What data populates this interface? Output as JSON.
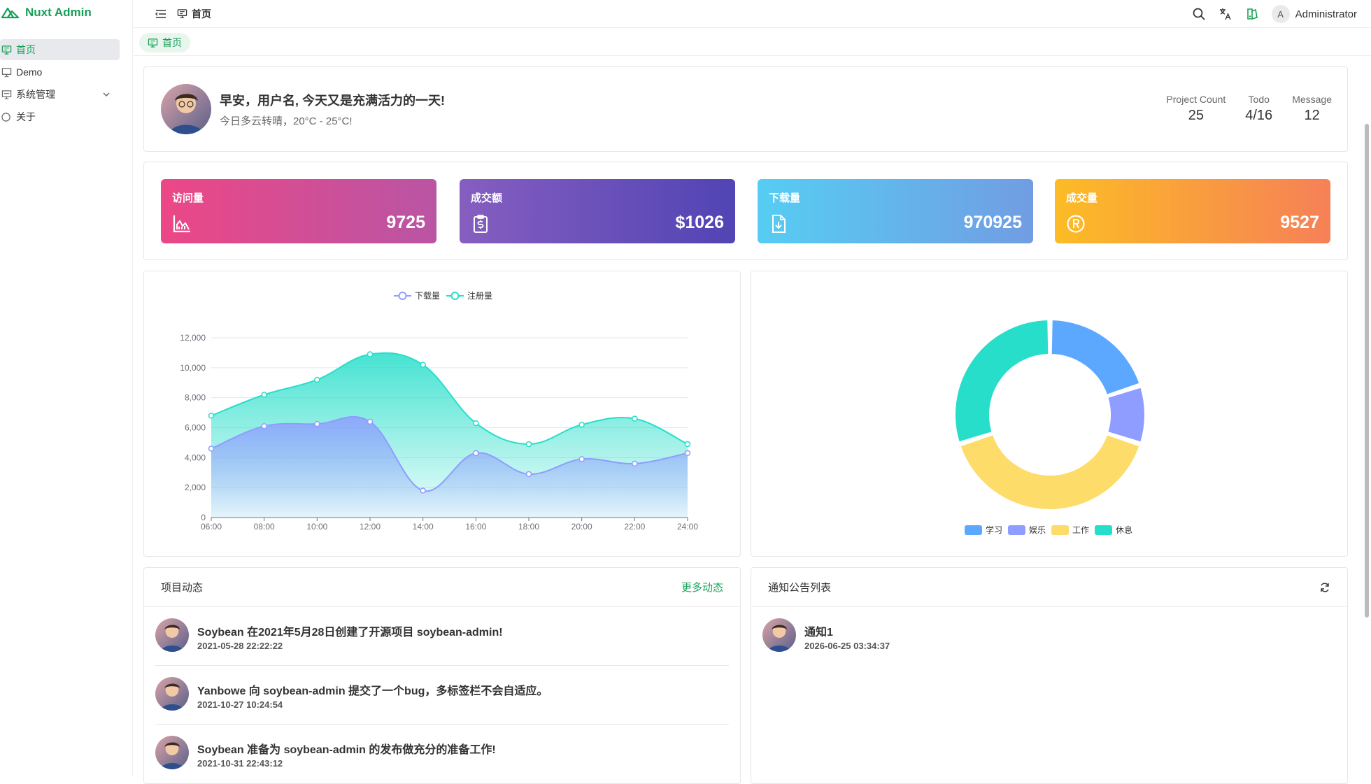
{
  "app": {
    "title": "Nuxt Admin"
  },
  "sidebar": {
    "items": [
      {
        "label": "首页",
        "icon": "monitor-icon",
        "active": true
      },
      {
        "label": "Demo",
        "icon": "presentation-icon"
      },
      {
        "label": "系统管理",
        "icon": "system-icon",
        "expandable": true
      },
      {
        "label": "关于",
        "icon": "circle-icon"
      }
    ]
  },
  "header": {
    "breadcrumb": "首页",
    "user_initial": "A",
    "user_name": "Administrator"
  },
  "tabs": [
    {
      "label": "首页"
    }
  ],
  "greeting": {
    "title": "早安，用户名, 今天又是充满活力的一天!",
    "subtitle": "今日多云转晴，20°C - 25°C!",
    "stats": [
      {
        "label": "Project Count",
        "value": "25"
      },
      {
        "label": "Todo",
        "value": "4/16"
      },
      {
        "label": "Message",
        "value": "12"
      }
    ]
  },
  "kpis": [
    {
      "title": "访问量",
      "value": "9725",
      "icon": "chart-icon",
      "from": "#ec4786",
      "to": "#b955a4"
    },
    {
      "title": "成交额",
      "value": "$1026",
      "icon": "money-clipboard-icon",
      "from": "#865ec0",
      "to": "#5144b4"
    },
    {
      "title": "下载量",
      "value": "970925",
      "icon": "download-file-icon",
      "from": "#56cdf3",
      "to": "#719de3"
    },
    {
      "title": "成交量",
      "value": "9527",
      "icon": "registered-icon",
      "from": "#fcbc25",
      "to": "#f68057"
    }
  ],
  "chart_data": [
    {
      "type": "area",
      "legend": [
        "下载量",
        "注册量"
      ],
      "legend_position": "top-center",
      "x": [
        "06:00",
        "08:00",
        "10:00",
        "12:00",
        "14:00",
        "16:00",
        "18:00",
        "20:00",
        "22:00",
        "24:00"
      ],
      "ylim": [
        0,
        12000
      ],
      "yticks": [
        "0",
        "2,000",
        "4,000",
        "6,000",
        "8,000",
        "10,000",
        "12,000"
      ],
      "grid": true,
      "series": [
        {
          "name": "下载量",
          "color": "#8e9dff",
          "values": [
            4600,
            6100,
            6250,
            6400,
            1800,
            4300,
            2900,
            3900,
            3600,
            4300
          ]
        },
        {
          "name": "注册量",
          "color": "#26deca",
          "values": [
            6800,
            8200,
            9200,
            10900,
            10200,
            6300,
            4900,
            6200,
            6600,
            4900
          ]
        }
      ]
    },
    {
      "type": "pie",
      "donut": true,
      "legend_position": "bottom-center",
      "categories": [
        "学习",
        "娱乐",
        "工作",
        "休息"
      ],
      "values": [
        20,
        10,
        40,
        30
      ],
      "colors": [
        "#5da8ff",
        "#8e9dff",
        "#fedc69",
        "#26deca"
      ]
    }
  ],
  "project_feed": {
    "title": "项目动态",
    "more": "更多动态",
    "items": [
      {
        "text": "Soybean 在2021年5月28日创建了开源项目 soybean-admin!",
        "time": "2021-05-28 22:22:22"
      },
      {
        "text": "Yanbowe 向 soybean-admin 提交了一个bug，多标签栏不会自适应。",
        "time": "2021-10-27 10:24:54"
      },
      {
        "text": "Soybean 准备为 soybean-admin 的发布做充分的准备工作!",
        "time": "2021-10-31 22:43:12"
      }
    ]
  },
  "notices": {
    "title": "通知公告列表",
    "items": [
      {
        "text": "通知1",
        "time": "2026-06-25 03:34:37"
      }
    ]
  }
}
